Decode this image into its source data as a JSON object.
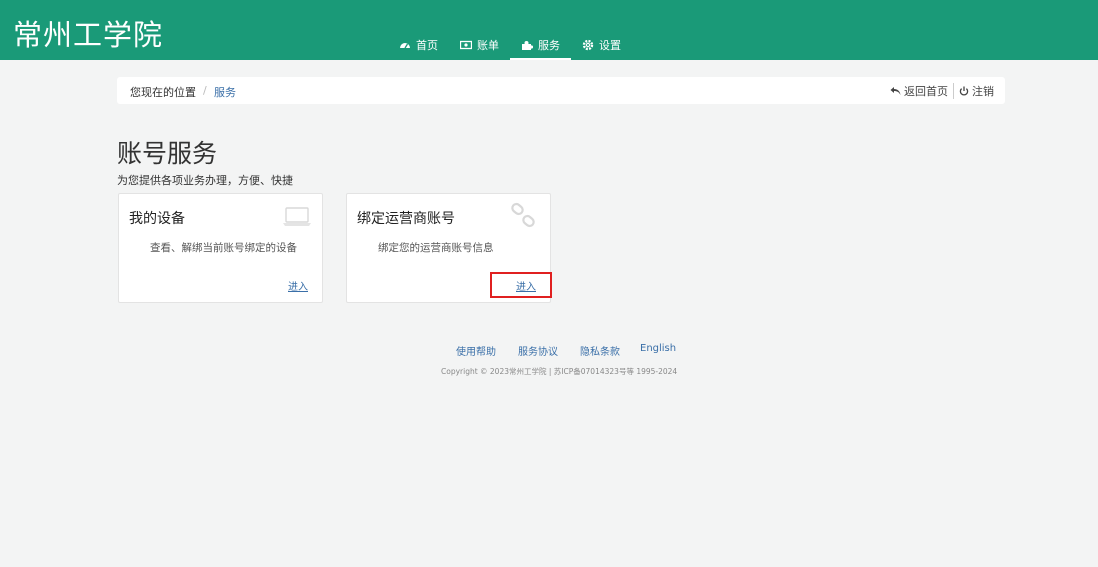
{
  "header": {
    "brand": "常州工学院",
    "nav": [
      {
        "label": "首页",
        "icon": "dashboard-icon",
        "active": false
      },
      {
        "label": "账单",
        "icon": "bill-icon",
        "active": false
      },
      {
        "label": "服务",
        "icon": "puzzle-icon",
        "active": true
      },
      {
        "label": "设置",
        "icon": "gear-icon",
        "active": false
      }
    ],
    "colors": {
      "bg": "#1a9a78",
      "text": "#ffffff"
    }
  },
  "breadcrumb": {
    "prefix": "您现在的位置",
    "separator": "/",
    "current": "服务",
    "links": [
      {
        "label": "返回首页",
        "icon": "reply-arrow-icon"
      },
      {
        "label": "注销",
        "icon": "power-icon"
      }
    ]
  },
  "page": {
    "title": "账号服务",
    "subtitle": "为您提供各项业务办理，方便、快捷"
  },
  "cards": [
    {
      "title": "我的设备",
      "desc": "查看、解绑当前账号绑定的设备",
      "link": "进入",
      "icon": "laptop-icon"
    },
    {
      "title": "绑定运营商账号",
      "desc": "绑定您的运营商账号信息",
      "link": "进入",
      "icon": "chain-link-icon",
      "highlighted": true
    }
  ],
  "footer": {
    "links": [
      "使用帮助",
      "服务协议",
      "隐私条款",
      "English"
    ],
    "copyright": "Copyright © 2023常州工学院 | 苏ICP备07014323号等 1995-2024"
  },
  "colors": {
    "accent": "#1a9a78",
    "link": "#3a6fa8",
    "highlight": "#e02020",
    "background": "#f3f4f4"
  }
}
